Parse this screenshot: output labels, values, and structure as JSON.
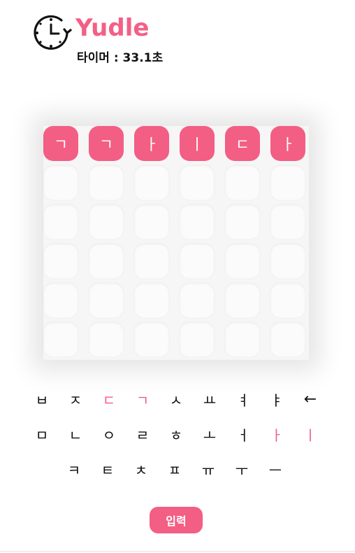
{
  "app": {
    "title": "Yudle",
    "timer": "타이머 : 33.1초",
    "enter_label": "입력"
  },
  "colors": {
    "accent": "#f35e84",
    "tile_empty": "#fbfbfb"
  },
  "board": {
    "rows": [
      [
        "ㄱ",
        "ㄱ",
        "ㅏ",
        "ㅣ",
        "ㄷ",
        "ㅏ"
      ],
      [
        "",
        "",
        "",
        "",
        "",
        ""
      ],
      [
        "",
        "",
        "",
        "",
        "",
        ""
      ],
      [
        "",
        "",
        "",
        "",
        "",
        ""
      ],
      [
        "",
        "",
        "",
        "",
        "",
        ""
      ],
      [
        "",
        "",
        "",
        "",
        "",
        ""
      ]
    ]
  },
  "keyboard": {
    "rows": [
      [
        {
          "k": "ㅂ",
          "used": false
        },
        {
          "k": "ㅈ",
          "used": false
        },
        {
          "k": "ㄷ",
          "used": true
        },
        {
          "k": "ㄱ",
          "used": true
        },
        {
          "k": "ㅅ",
          "used": false
        },
        {
          "k": "ㅛ",
          "used": false
        },
        {
          "k": "ㅕ",
          "used": false
        },
        {
          "k": "ㅑ",
          "used": false
        },
        {
          "k": "←",
          "used": false
        }
      ],
      [
        {
          "k": "ㅁ",
          "used": false
        },
        {
          "k": "ㄴ",
          "used": false
        },
        {
          "k": "ㅇ",
          "used": false
        },
        {
          "k": "ㄹ",
          "used": false
        },
        {
          "k": "ㅎ",
          "used": false
        },
        {
          "k": "ㅗ",
          "used": false
        },
        {
          "k": "ㅓ",
          "used": false
        },
        {
          "k": "ㅏ",
          "used": true
        },
        {
          "k": "ㅣ",
          "used": true
        }
      ],
      [
        {
          "k": "ㅋ",
          "used": false
        },
        {
          "k": "ㅌ",
          "used": false
        },
        {
          "k": "ㅊ",
          "used": false
        },
        {
          "k": "ㅍ",
          "used": false
        },
        {
          "k": "ㅠ",
          "used": false
        },
        {
          "k": "ㅜ",
          "used": false
        },
        {
          "k": "ㅡ",
          "used": false
        }
      ]
    ]
  }
}
